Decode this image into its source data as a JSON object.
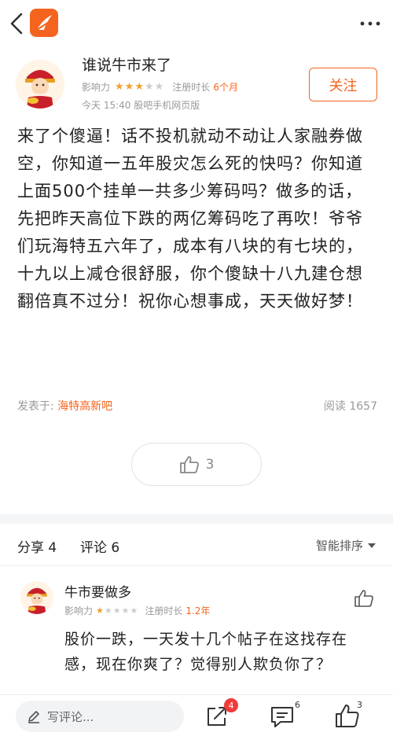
{
  "post": {
    "author": "谁说牛市来了",
    "influence_label": "影响力",
    "influence_stars": 3,
    "reg_label": "注册时长",
    "reg_value": "6个月",
    "time_source": "今天 15:40 股吧手机网页版",
    "follow_label": "关注",
    "content": "来了个傻逼！话不投机就动不动让人家融券做空，你知道一五年股灾怎么死的快吗？你知道上面500个挂单一共多少筹码吗？做多的话，先把昨天高位下跌的两亿筹码吃了再吹！爷爷们玩海特五六年了，成本有八块的有七块的，十九以上减仓很舒服，你个傻缺十八九建仓想翻倍真不过分！祝你心想事成，天天做好梦！",
    "published_label": "发表于:",
    "bar_name": "海特高新吧",
    "reads_label": "阅读",
    "reads_count": "1657",
    "like_count": "3"
  },
  "tabs": {
    "share": "分享 4",
    "comment": "评论 6",
    "sort": "智能排序"
  },
  "comment": {
    "author": "牛市要做多",
    "influence_label": "影响力",
    "influence_stars": 1,
    "reg_label": "注册时长",
    "reg_value": "1.2年",
    "text": "股价一跌，一天发十几个帖子在这找存在感，现在你爽了？觉得别人欺负你了？"
  },
  "bottom": {
    "write_placeholder": "写评论...",
    "share_badge": "4",
    "comment_count": "6",
    "like_count": "3"
  },
  "colors": {
    "accent": "#f4641e",
    "star": "#f0a030",
    "badge": "#f23a3a"
  }
}
